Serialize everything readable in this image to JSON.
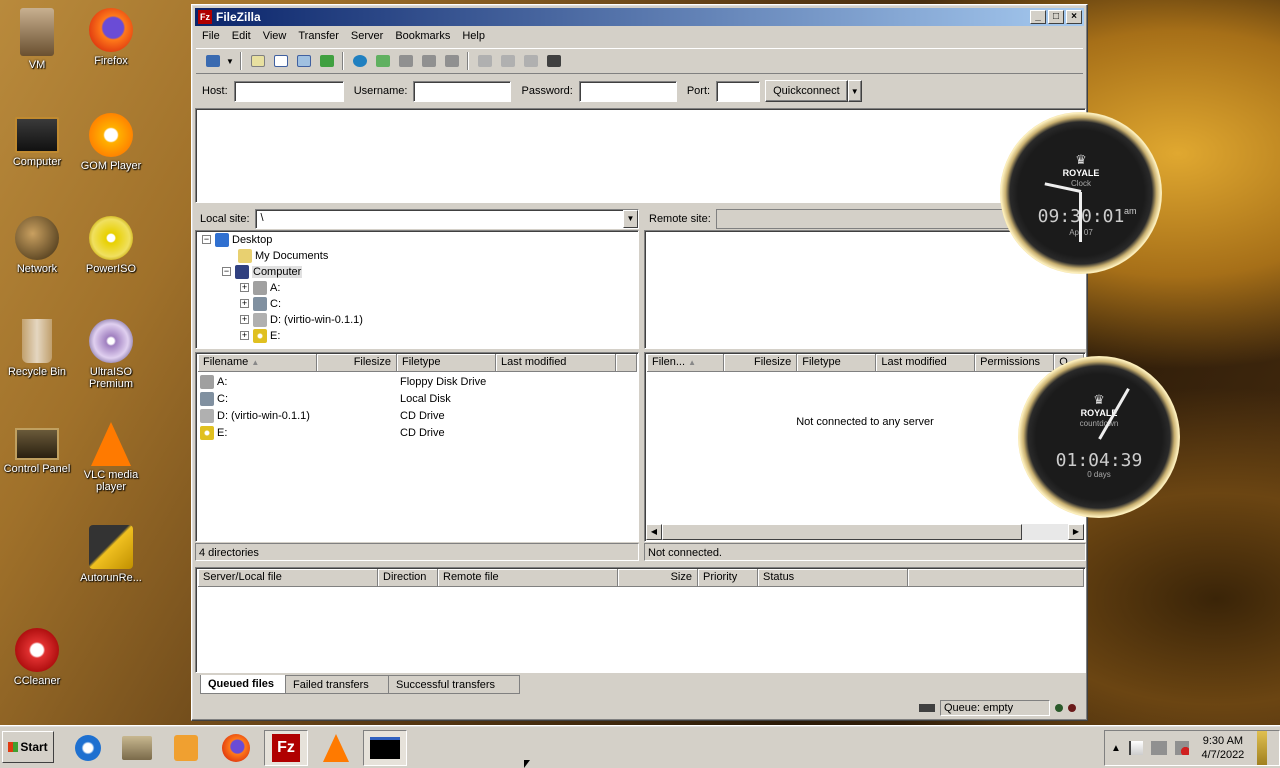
{
  "desktop": {
    "icons": [
      {
        "label": "VM"
      },
      {
        "label": "Firefox"
      },
      {
        "label": "Computer"
      },
      {
        "label": "GOM Player"
      },
      {
        "label": "Network"
      },
      {
        "label": "PowerISO"
      },
      {
        "label": "Recycle Bin"
      },
      {
        "label": "UltraISO Premium"
      },
      {
        "label": "Control Panel"
      },
      {
        "label": "VLC media player"
      },
      {
        "label": "AutorunRe..."
      },
      {
        "label": "CCleaner"
      }
    ]
  },
  "window": {
    "title": "FileZilla",
    "menu": [
      "File",
      "Edit",
      "View",
      "Transfer",
      "Server",
      "Bookmarks",
      "Help"
    ],
    "quickconnect": {
      "host_label": "Host:",
      "username_label": "Username:",
      "password_label": "Password:",
      "port_label": "Port:",
      "button": "Quickconnect",
      "host": "",
      "username": "",
      "password": "",
      "port": ""
    },
    "local": {
      "site_label": "Local site:",
      "path": "\\",
      "tree": [
        "Desktop",
        "My Documents",
        "Computer",
        "A:",
        "C:",
        "D: (virtio-win-0.1.1)",
        "E:"
      ],
      "columns": [
        "Filename",
        "Filesize",
        "Filetype",
        "Last modified"
      ],
      "rows": [
        {
          "name": "A:",
          "type": "Floppy Disk Drive"
        },
        {
          "name": "C:",
          "type": "Local Disk"
        },
        {
          "name": "D: (virtio-win-0.1.1)",
          "type": "CD Drive"
        },
        {
          "name": "E:",
          "type": "CD Drive"
        }
      ],
      "status": "4 directories"
    },
    "remote": {
      "site_label": "Remote site:",
      "columns": [
        "Filen...",
        "Filesize",
        "Filetype",
        "Last modified",
        "Permissions",
        "O"
      ],
      "empty_message": "Not connected to any server",
      "status": "Not connected."
    },
    "queue": {
      "columns": [
        "Server/Local file",
        "Direction",
        "Remote file",
        "Size",
        "Priority",
        "Status"
      ],
      "tabs": [
        "Queued files",
        "Failed transfers",
        "Successful transfers"
      ],
      "queue_status": "Queue: empty"
    }
  },
  "clocks": {
    "clock": {
      "brand": "ROYALE",
      "sub": "Clock",
      "time": "09:30:01",
      "ampm": "am",
      "date": "Apr 07"
    },
    "countdown": {
      "brand": "ROYALE",
      "sub": "countdown",
      "time": "01:04:39",
      "days": "0 days"
    }
  },
  "taskbar": {
    "start": "Start",
    "time": "9:30 AM",
    "date": "4/7/2022"
  },
  "colors": {
    "titlebar": "#0a246a",
    "accent": "#a6caf0"
  }
}
